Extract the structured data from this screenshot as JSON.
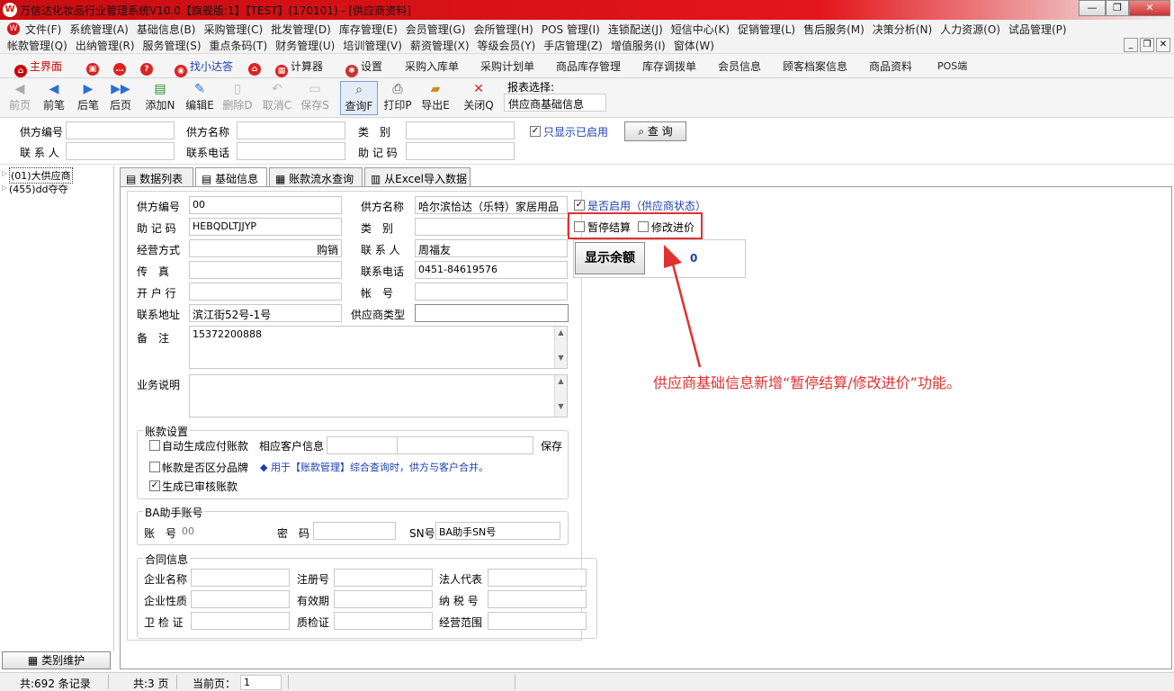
{
  "window": {
    "title": "万信达化妆品行业管理系统V10.0【旗舰版:1】【TEST】(170101) - [供应商资料]",
    "controls": [
      "—",
      "❐",
      "✕"
    ]
  },
  "menu": {
    "row1": [
      "文件(F)",
      "系统管理(A)",
      "基础信息(B)",
      "采购管理(C)",
      "批发管理(D)",
      "库存管理(E)",
      "会员管理(G)",
      "会所管理(H)",
      "POS 管理(I)",
      "连锁配送(J)",
      "短信中心(K)",
      "促销管理(L)",
      "售后服务(M)",
      "决策分析(N)",
      "人力资源(O)",
      "试品管理(P)"
    ],
    "row2": [
      "帐款管理(Q)",
      "出纳管理(R)",
      "服务管理(S)",
      "重点条码(T)",
      "财务管理(U)",
      "培训管理(V)",
      "薪资管理(X)",
      "等级会员(Y)",
      "手店管理(Z)",
      "增值服务(I)",
      "窗体(W)"
    ]
  },
  "quickbar": {
    "home": "主界面",
    "finder": "找小达答",
    "calculator": "计算器",
    "settings": "设置",
    "links": [
      "采购入库单",
      "采购计划单",
      "商品库存管理",
      "库存调拨单",
      "会员信息",
      "顾客档案信息",
      "商品资料",
      "POS端"
    ]
  },
  "toolbar": {
    "first": "前页",
    "prev": "前笔",
    "next": "后笔",
    "last": "后页",
    "add": "添加N",
    "edit": "编辑E",
    "delete": "删除D",
    "cancel": "取消C",
    "save": "保存S",
    "query": "查询F",
    "print": "打印P",
    "export": "导出E",
    "close": "关闭Q",
    "report_label": "报表选择:",
    "report_value": "供应商基础信息"
  },
  "search": {
    "code_label": "供方编号",
    "name_label": "供方名称",
    "type_label": "类　别",
    "contact_label": "联 系 人",
    "phone_label": "联系电话",
    "memo_label": "助 记 码",
    "only_enabled": "只显示已启用",
    "query_button": "查 询"
  },
  "tree": {
    "nodes": [
      "(01)大供应商",
      "(455)dd夺夺"
    ],
    "category_button": "类别维护"
  },
  "tabs": [
    "数据列表",
    "基础信息",
    "账款流水查询",
    "从Excel导入数据"
  ],
  "form": {
    "supplier_code_label": "供方编号",
    "supplier_code": "00",
    "supplier_name_label": "供方名称",
    "supplier_name": "哈尔滨恰达（乐特）家居用品",
    "memo_code_label": "助 记 码",
    "memo_code": "HEBQDLTJJYP",
    "category_label": "类　别",
    "category": "",
    "business_mode_label": "经营方式",
    "business_mode": "购销",
    "contact_label": "联 系 人",
    "contact": "周福友",
    "fax_label": "传　真",
    "fax": "",
    "phone_label": "联系电话",
    "phone": "0451-84619576",
    "bank_label": "开 户 行",
    "bank": "",
    "account_label": "帐　号",
    "account": "",
    "address_label": "联系地址",
    "address": "滨江街52号-1号",
    "supplier_type_label": "供应商类型",
    "supplier_type": "",
    "remark_label": "备　注",
    "remark": "15372200888",
    "business_desc_label": "业务说明",
    "business_desc": "",
    "enabled_label": "是否启用（供应商状态）",
    "pause_settlement_label": "暂停结算",
    "modify_price_label": "修改进价",
    "show_balance_button": "显示余额",
    "balance": "0"
  },
  "account_settings": {
    "title": "账款设置",
    "auto_payable": "自动生成应付账款",
    "customer_info_label": "相应客户信息",
    "save_label": "保存",
    "brand_split": "帐款是否区分品牌",
    "brand_note": "◆ 用于【账款管理】综合查询时，供方与客户合并。",
    "audited": "生成已审核账款"
  },
  "ba_account": {
    "title": "BA助手账号",
    "account_label": "账　号",
    "account": "00",
    "password_label": "密　码",
    "password": "",
    "sn_label": "SN号",
    "sn": "BA助手SN号"
  },
  "contract": {
    "title": "合同信息",
    "company_name": "企业名称",
    "reg_no": "注册号",
    "legal_rep": "法人代表",
    "company_type": "企业性质",
    "valid_period": "有效期",
    "tax_no": "纳 税 号",
    "health_cert": "卫 检 证",
    "quality_cert": "质检证",
    "business_scope": "经营范围"
  },
  "annotation": "供应商基础信息新增“暂停结算/修改进价”功能。",
  "status": {
    "records": "共:692 条记录",
    "pages": "共:3 页",
    "current_page_label": "当前页：",
    "current_page": "1"
  },
  "colors": {
    "title_red": "#d7151a",
    "annotation_red": "#e03030",
    "link_blue": "#1a3fb0"
  }
}
